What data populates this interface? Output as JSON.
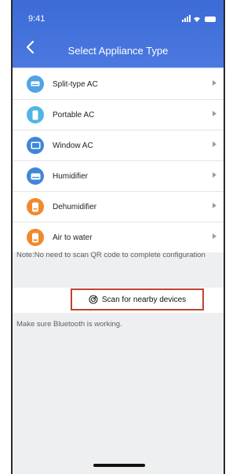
{
  "status_bar": {
    "time": "9:41"
  },
  "header": {
    "title": "Select Appliance Type"
  },
  "appliances": [
    {
      "label": "Split-type AC",
      "color": "#4fa3e6"
    },
    {
      "label": "Portable AC",
      "color": "#4fb4e8"
    },
    {
      "label": "Window AC",
      "color": "#3f86d8"
    },
    {
      "label": "Humidifier",
      "color": "#3f86d8"
    },
    {
      "label": "Dehumidifier",
      "color": "#ef8a2c"
    },
    {
      "label": "Air to water",
      "color": "#ef8a2c"
    }
  ],
  "note": "Note:No need to scan QR code to complete configuration",
  "scan": {
    "label": "Scan for nearby devices"
  },
  "hint": "Make sure Bluetooth is working.",
  "colors": {
    "header": "#3d6bd6",
    "highlight_border": "#c1432e"
  }
}
